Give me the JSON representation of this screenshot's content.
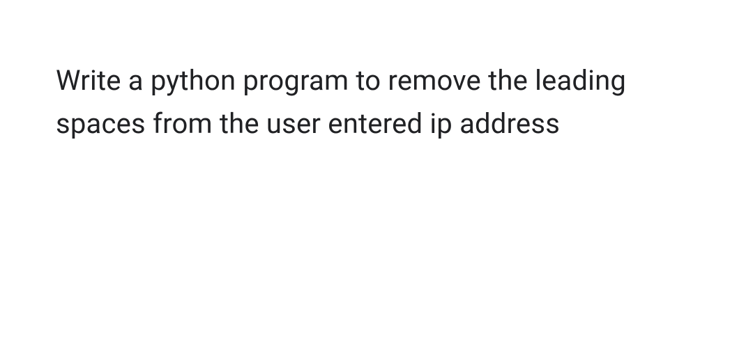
{
  "prompt": {
    "text": "Write a python program to remove the leading spaces from the user entered ip address"
  }
}
